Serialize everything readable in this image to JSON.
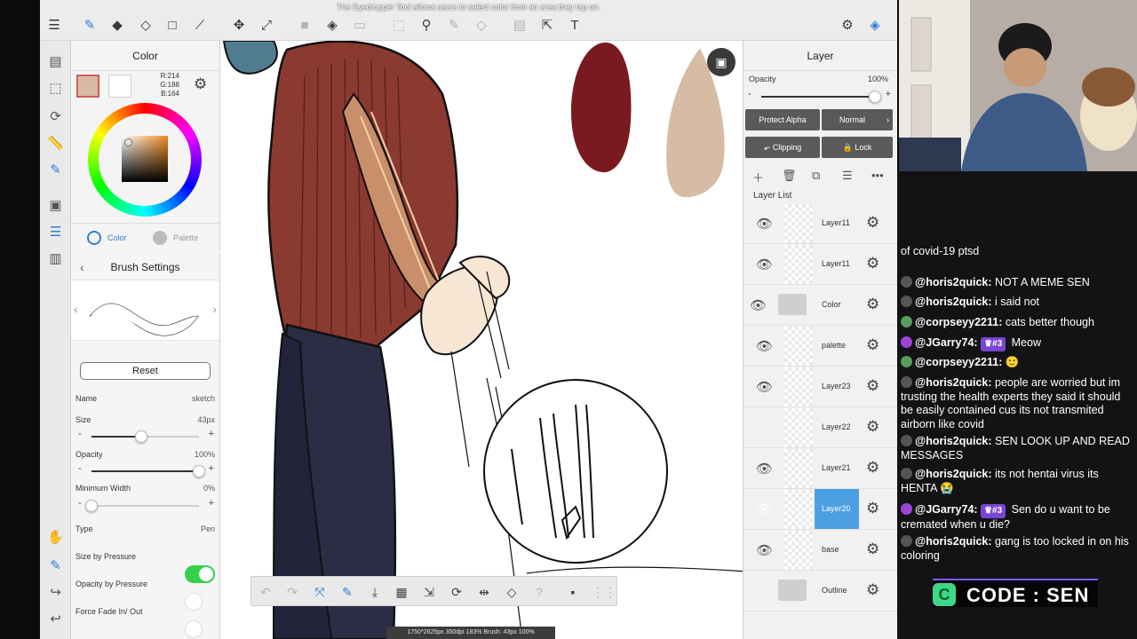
{
  "tooltip": "The Eyedropper Tool allows users to select color from an area they tap on.",
  "color_panel": {
    "title": "Color",
    "rgb": {
      "r": "R:214",
      "g": "G:188",
      "b": "B:164"
    },
    "main_color": "#d6bca4",
    "tabs": {
      "color": "Color",
      "palette": "Palette"
    }
  },
  "brush": {
    "title": "Brush Settings",
    "reset": "Reset",
    "name_label": "Name",
    "name_value": "sketch",
    "size_label": "Size",
    "size_value": "43px",
    "opacity_label": "Opacity",
    "opacity_value": "100%",
    "minwidth_label": "Minimum Width",
    "minwidth_value": "0%",
    "type_label": "Type",
    "type_value": "Pen",
    "size_pressure": "Size by Pressure",
    "opacity_pressure": "Opacity by Pressure",
    "force_fade": "Force Fade In/ Out",
    "size_level": 0.46,
    "opacity_level": 1.0,
    "minwidth_level": 0.0,
    "size_pressure_on": true,
    "toggle_color": "#35d04a"
  },
  "layer_panel": {
    "title": "Layer",
    "opacity_label": "Opacity",
    "opacity_value": "100%",
    "protect_alpha": "Protect Alpha",
    "blend_mode": "Normal",
    "clipping": "Clipping",
    "lock": "Lock",
    "list_label": "Layer List",
    "layers": [
      "Layer11",
      "Layer11",
      "Color",
      "palette",
      "Layer23",
      "Layer22",
      "Layer21",
      "Layer20",
      "base",
      "Outline"
    ],
    "selected_color": "#4d9fe3"
  },
  "status": "1750*2625px 350dpi 183% Brush: 43px 100%",
  "chat": {
    "messages": [
      {
        "user": "",
        "text": "of covid-19 ptsd",
        "badge": ""
      },
      {
        "user": "@horis2quick:",
        "text": "NOT A MEME SEN",
        "badge": ""
      },
      {
        "user": "@horis2quick:",
        "text": "i said not",
        "badge": ""
      },
      {
        "user": "@corpseyy2211:",
        "text": "cats better though",
        "badge": ""
      },
      {
        "user": "@JGarry74:",
        "text": "Meow",
        "badge": "♛#3"
      },
      {
        "user": "@corpseyy2211:",
        "text": "🙂",
        "badge": ""
      },
      {
        "user": "@horis2quick:",
        "text": "people are worried but im trusting the health experts they said it should be easily contained cus its not transmited airborn like covid",
        "badge": ""
      },
      {
        "user": "@horis2quick:",
        "text": "SEN LOOK UP AND READ MESSAGES",
        "badge": ""
      },
      {
        "user": "@horis2quick:",
        "text": "its not hentai virus its HENTA 😭",
        "badge": ""
      },
      {
        "user": "@JGarry74:",
        "text": "Sen do u want to be cremated when u die?",
        "badge": "♛#3"
      },
      {
        "user": "@horis2quick:",
        "text": "gang is too locked in on his coloring",
        "badge": ""
      }
    ],
    "code_label": "CODE : SEN",
    "code_icon": "C"
  }
}
